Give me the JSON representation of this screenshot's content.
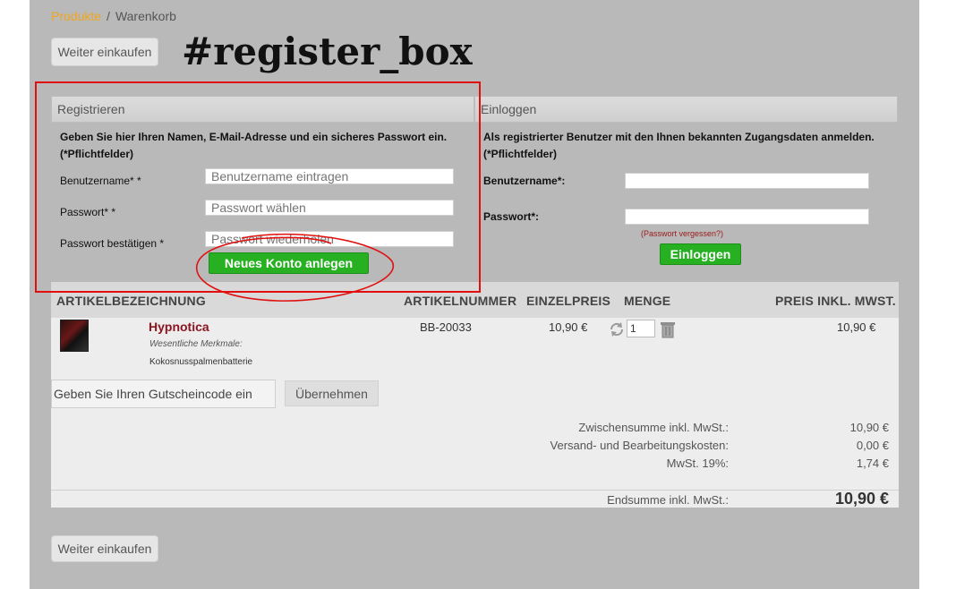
{
  "breadcrumb": {
    "products": "Produkte",
    "separator": "/",
    "current": "Warenkorb"
  },
  "buttons": {
    "continue_shopping_top": "Weiter einkaufen",
    "continue_shopping_bottom": "Weiter einkaufen",
    "create_account": "Neues Konto anlegen",
    "login": "Einloggen",
    "apply_coupon": "Übernehmen"
  },
  "annotation": {
    "title": "#register_box",
    "color": "#e01010"
  },
  "register": {
    "header": "Registrieren",
    "intro": "Geben Sie hier Ihren Namen, E-Mail-Adresse und ein sicheres Passwort ein.",
    "required_note": "(*Pflichtfelder)",
    "username_label": "Benutzername* *",
    "username_placeholder": "Benutzername eintragen",
    "password_label": "Passwort* *",
    "password_placeholder": "Passwort wählen",
    "confirm_label": "Passwort bestätigen *",
    "confirm_placeholder": "Passwort wiederholen"
  },
  "login": {
    "header": "Einloggen",
    "intro": "Als registrierter Benutzer mit den Ihnen bekannten Zugangsdaten anmelden.",
    "required_note": "(*Pflichtfelder)",
    "username_label": "Benutzername*:",
    "password_label": "Passwort*:",
    "forgot_password": "(Passwort vergessen?)"
  },
  "cart": {
    "columns": [
      "ARTIKELBEZEICHNUNG",
      "ARTIKELNUMMER",
      "EINZELPREIS",
      "MENGE",
      "PREIS INKL. MWST."
    ],
    "items": [
      {
        "name": "Hypnotica",
        "feature_label": "Wesentliche Merkmale:",
        "feature_value": "Kokosnusspalmenbatterie",
        "article_number": "BB-20033",
        "unit_price": "10,90 €",
        "quantity": "1",
        "total_price": "10,90 €"
      }
    ],
    "coupon_placeholder": "Geben Sie Ihren Gutscheincode ein",
    "summary": {
      "subtotal_label": "Zwischensumme inkl. MwSt.:",
      "subtotal_value": "10,90 €",
      "shipping_label": "Versand- und Bearbeitungskosten:",
      "shipping_value": "0,00 €",
      "vat_label": "MwSt. 19%:",
      "vat_value": "1,74 €",
      "total_label": "Endsumme inkl. MwSt.:",
      "total_value": "10,90 €"
    }
  },
  "colors": {
    "accent_green": "#27b022",
    "breadcrumb_link": "#f0a61e",
    "product_name": "#8b1520"
  },
  "icons": {
    "refresh": "refresh-icon",
    "delete": "trash-icon"
  }
}
